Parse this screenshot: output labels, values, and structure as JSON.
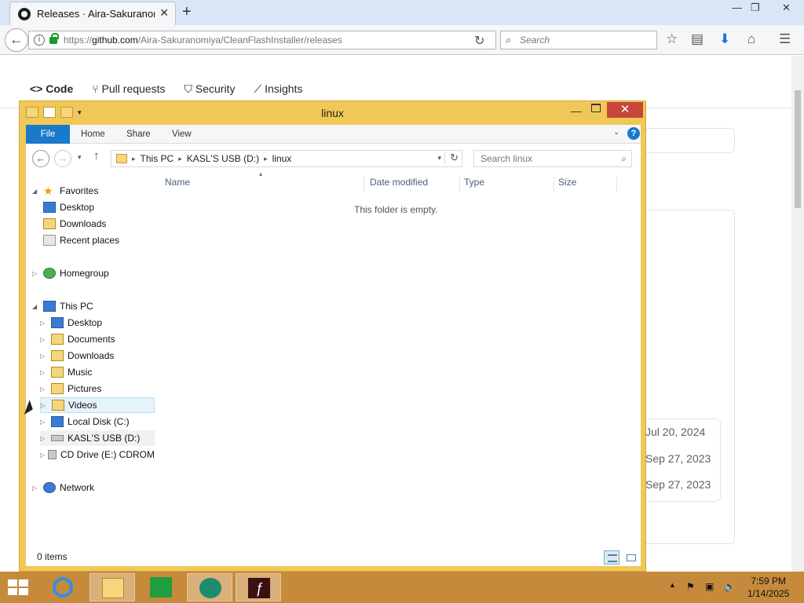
{
  "browser": {
    "tab_title": "Releases · Aira-Sakuranomiya",
    "url_prefix": "https://",
    "url_domain": "github.com",
    "url_path": "/Aira-Sakuranomiya/CleanFlashInstaller/releases",
    "search_placeholder": "Search"
  },
  "github": {
    "tabs": [
      "Code",
      "Pull requests",
      "Security",
      "Insights"
    ],
    "release_dates": [
      "Jul 20, 2024",
      "Sep 27, 2023",
      "Sep 27, 2023"
    ]
  },
  "explorer": {
    "title": "linux",
    "ribbon_tabs": {
      "file": "File",
      "home": "Home",
      "share": "Share",
      "view": "View"
    },
    "breadcrumb": [
      "This PC",
      "KASL'S USB (D:)",
      "linux"
    ],
    "search_placeholder": "Search linux",
    "nav": {
      "favorites": "Favorites",
      "desktop_fav": "Desktop",
      "downloads_fav": "Downloads",
      "recent": "Recent places",
      "homegroup": "Homegroup",
      "this_pc": "This PC",
      "desktop": "Desktop",
      "documents": "Documents",
      "downloads": "Downloads",
      "music": "Music",
      "pictures": "Pictures",
      "videos": "Videos",
      "local_disk": "Local Disk (C:)",
      "usb": "KASL'S USB (D:)",
      "cd": "CD Drive (E:) CDROM",
      "network": "Network"
    },
    "columns": {
      "name": "Name",
      "date": "Date modified",
      "type": "Type",
      "size": "Size"
    },
    "empty_message": "This folder is empty.",
    "status": "0 items"
  },
  "taskbar": {
    "time": "7:59 PM",
    "date": "1/14/2025"
  },
  "colors": {
    "window_frame": "#f0c858",
    "taskbar": "#c68a3c",
    "close_button": "#c7463a",
    "accent": "#1979ca"
  }
}
